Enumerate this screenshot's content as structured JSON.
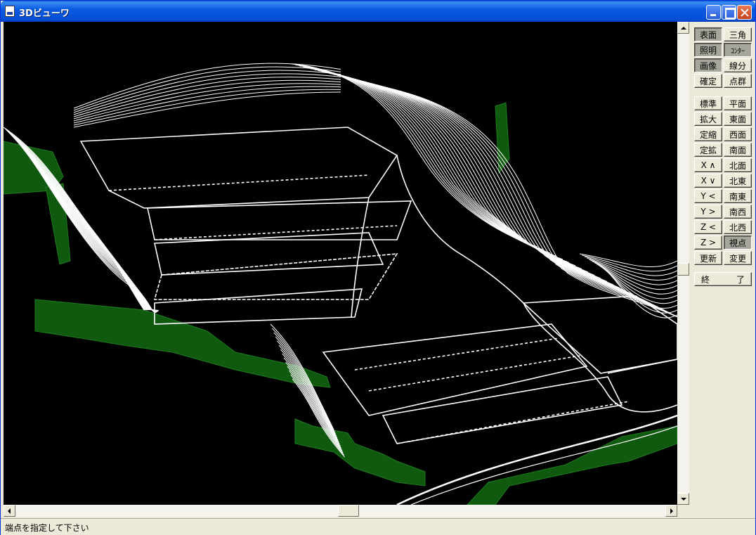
{
  "window": {
    "title": "3Dビューワ"
  },
  "panel": {
    "buttons": [
      {
        "label": "表面",
        "pressed": true
      },
      {
        "label": "三角",
        "pressed": false
      },
      {
        "label": "照明",
        "pressed": true
      },
      {
        "label": "ｺﾝﾀｰ",
        "pressed": true
      },
      {
        "label": "画像",
        "pressed": true
      },
      {
        "label": "線分",
        "pressed": false
      },
      {
        "label": "確定",
        "pressed": false
      },
      {
        "label": "点群",
        "pressed": false
      },
      {
        "label": "標準",
        "pressed": false
      },
      {
        "label": "平面",
        "pressed": false
      },
      {
        "label": "拡大",
        "pressed": false
      },
      {
        "label": "東面",
        "pressed": false
      },
      {
        "label": "定縮",
        "pressed": false
      },
      {
        "label": "西面",
        "pressed": false
      },
      {
        "label": "定拡",
        "pressed": false
      },
      {
        "label": "南面",
        "pressed": false
      },
      {
        "label": "X ∧",
        "pressed": false
      },
      {
        "label": "北面",
        "pressed": false
      },
      {
        "label": "X ∨",
        "pressed": false
      },
      {
        "label": "北東",
        "pressed": false
      },
      {
        "label": "Y <",
        "pressed": false
      },
      {
        "label": "南東",
        "pressed": false
      },
      {
        "label": "Y >",
        "pressed": false
      },
      {
        "label": "南西",
        "pressed": false
      },
      {
        "label": "Z <",
        "pressed": false
      },
      {
        "label": "北西",
        "pressed": false
      },
      {
        "label": "Z >",
        "pressed": false
      },
      {
        "label": "視点",
        "pressed": true
      },
      {
        "label": "更新",
        "pressed": false
      },
      {
        "label": "変更",
        "pressed": false
      }
    ],
    "exit_left": "終",
    "exit_right": "了"
  },
  "scroll": {
    "vertical_position": 0.52,
    "horizontal_position": 0.52
  },
  "status": {
    "message": "端点を指定して下さい"
  },
  "colors": {
    "terrain_side": "#0f5a0f",
    "contour": "#ffffff",
    "background": "#000000"
  }
}
